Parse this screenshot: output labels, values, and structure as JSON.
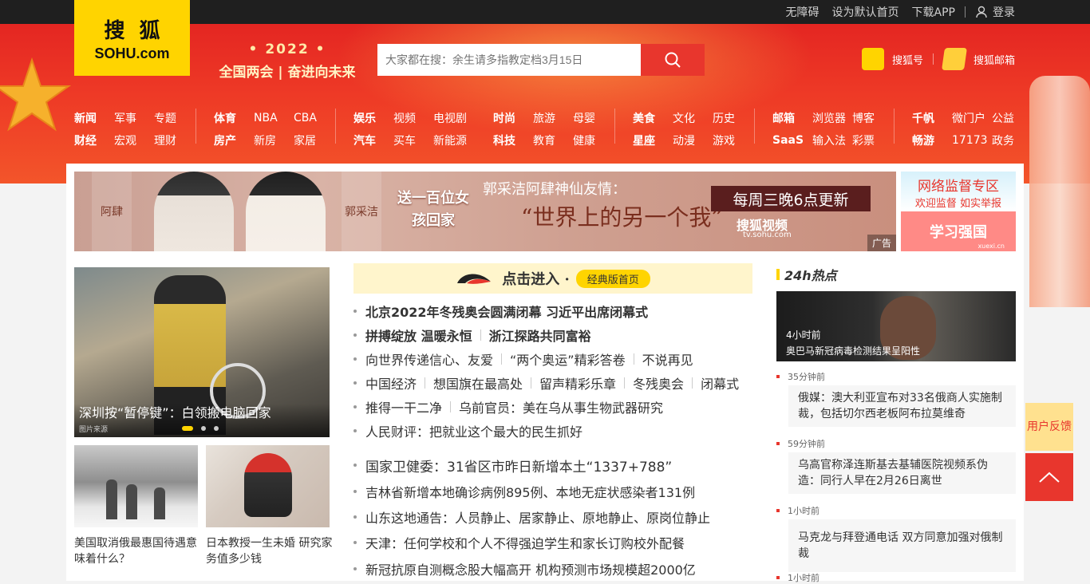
{
  "topbar": {
    "links": [
      "无障碍",
      "设为默认首页",
      "下载APP"
    ],
    "login": "登录"
  },
  "logo": {
    "cn": "搜狐",
    "en": "SOHU.com"
  },
  "slogan": {
    "year": "• 2022 •",
    "text": "全国两会 | 奋进向未来"
  },
  "search": {
    "placeholder": "大家都在搜：余生请多指教定档3月15日"
  },
  "header_links": {
    "sohuhao": "搜狐号",
    "mail": "搜狐邮箱"
  },
  "nav": [
    {
      "rows": [
        [
          "新闻",
          "军事",
          "专题"
        ],
        [
          "财经",
          "宏观",
          "理财"
        ]
      ]
    },
    {
      "rows": [
        [
          "体育",
          "NBA",
          "CBA"
        ],
        [
          "房产",
          "新房",
          "家居"
        ]
      ]
    },
    {
      "rows": [
        [
          "娱乐",
          "视频",
          "电视剧"
        ],
        [
          "汽车",
          "买车",
          "新能源"
        ]
      ]
    },
    {
      "rows": [
        [
          "时尚",
          "旅游",
          "母婴"
        ],
        [
          "科技",
          "教育",
          "健康"
        ]
      ]
    },
    {
      "rows": [
        [
          "美食",
          "文化",
          "历史"
        ],
        [
          "星座",
          "动漫",
          "游戏"
        ]
      ]
    },
    {
      "rows": [
        [
          "邮箱",
          "浏览器",
          "博客"
        ],
        [
          "SaaS",
          "输入法",
          "彩票"
        ]
      ]
    },
    {
      "rows": [
        [
          "千帆",
          "微门户",
          "公益"
        ],
        [
          "畅游",
          "17173",
          "政务"
        ]
      ]
    }
  ],
  "banner": {
    "side_left": "阿肆",
    "side_right": "郭采洁",
    "show_name": "送一百位女孩回家",
    "headline": "郭采洁阿肆神仙友情：",
    "quote": "“世界上的另一个我”",
    "update": "每周三晚6点更新",
    "brand": "搜狐视频",
    "url": "tv.sohu.com",
    "ad": "广告"
  },
  "side_ad": {
    "top1": "网络监督专区",
    "top2": "欢迎监督 如实举报",
    "bottom": "学习强国",
    "bottom_small": "xuexi.cn"
  },
  "slider": {
    "caption": "深圳按“暂停键”：白领搬电脑回家",
    "credit": "图片来源"
  },
  "thumbs": [
    {
      "caption": "美国取消俄最惠国待遇意味着什么？"
    },
    {
      "caption": "日本教授一生未婚 研究家务值多少钱"
    }
  ],
  "classic": {
    "enter": "点击进入 ·",
    "pill": "经典版首页"
  },
  "news": [
    {
      "items": [
        "北京2022年冬残奥会圆满闭幕 习近平出席闭幕式"
      ],
      "bold": true
    },
    {
      "items": [
        "拼搏绽放 温暖永恒",
        "浙江探路共同富裕"
      ],
      "bold": true
    },
    {
      "items": [
        "向世界传递信心、友爱",
        "“两个奥运”精彩答卷",
        "不说再见"
      ],
      "bold": false
    },
    {
      "items": [
        "中国经济",
        "想国旗在最高处",
        "留声精彩乐章",
        "冬残奥会",
        "闭幕式"
      ],
      "bold": false
    },
    {
      "items": [
        "推得一干二净",
        "乌前官员：美在乌从事生物武器研究"
      ],
      "bold": false
    },
    {
      "items": [
        "人民财评：把就业这个最大的民生抓好"
      ],
      "bold": false
    },
    {
      "items": [
        "国家卫健委：31省区市昨日新增本土“1337+788”"
      ],
      "bold": false
    },
    {
      "items": [
        "吉林省新增本地确诊病例895例、本地无症状感染者131例"
      ],
      "bold": false
    },
    {
      "items": [
        "山东这地通告：人员静止、居家静止、原地静止、原岗位静止"
      ],
      "bold": false
    },
    {
      "items": [
        "天津：任何学校和个人不得强迫学生和家长订购校外配餐"
      ],
      "bold": false
    },
    {
      "items": [
        "新冠抗原自测概念股大幅高开 机构预测市场规模超2000亿"
      ],
      "bold": false
    }
  ],
  "hot": {
    "title": "24h热点",
    "photo": {
      "time": "4小时前",
      "desc": "奥巴马新冠病毒检测结果呈阳性"
    },
    "items": [
      {
        "time": "35分钟前",
        "text": "俄媒：澳大利亚宣布对33名俄商人实施制裁，包括切尔西老板阿布拉莫维奇"
      },
      {
        "time": "59分钟前",
        "text": "乌高官称泽连斯基去基辅医院视频系伪造：同行人早在2月26日离世"
      },
      {
        "time": "1小时前",
        "text": "马克龙与拜登通电话 双方同意加强对俄制裁"
      },
      {
        "time": "1小时前",
        "text": ""
      }
    ]
  },
  "feedback": {
    "label": "用户反馈"
  },
  "colors": {
    "accent": "#e8362d",
    "brand_yellow": "#ffd400"
  }
}
